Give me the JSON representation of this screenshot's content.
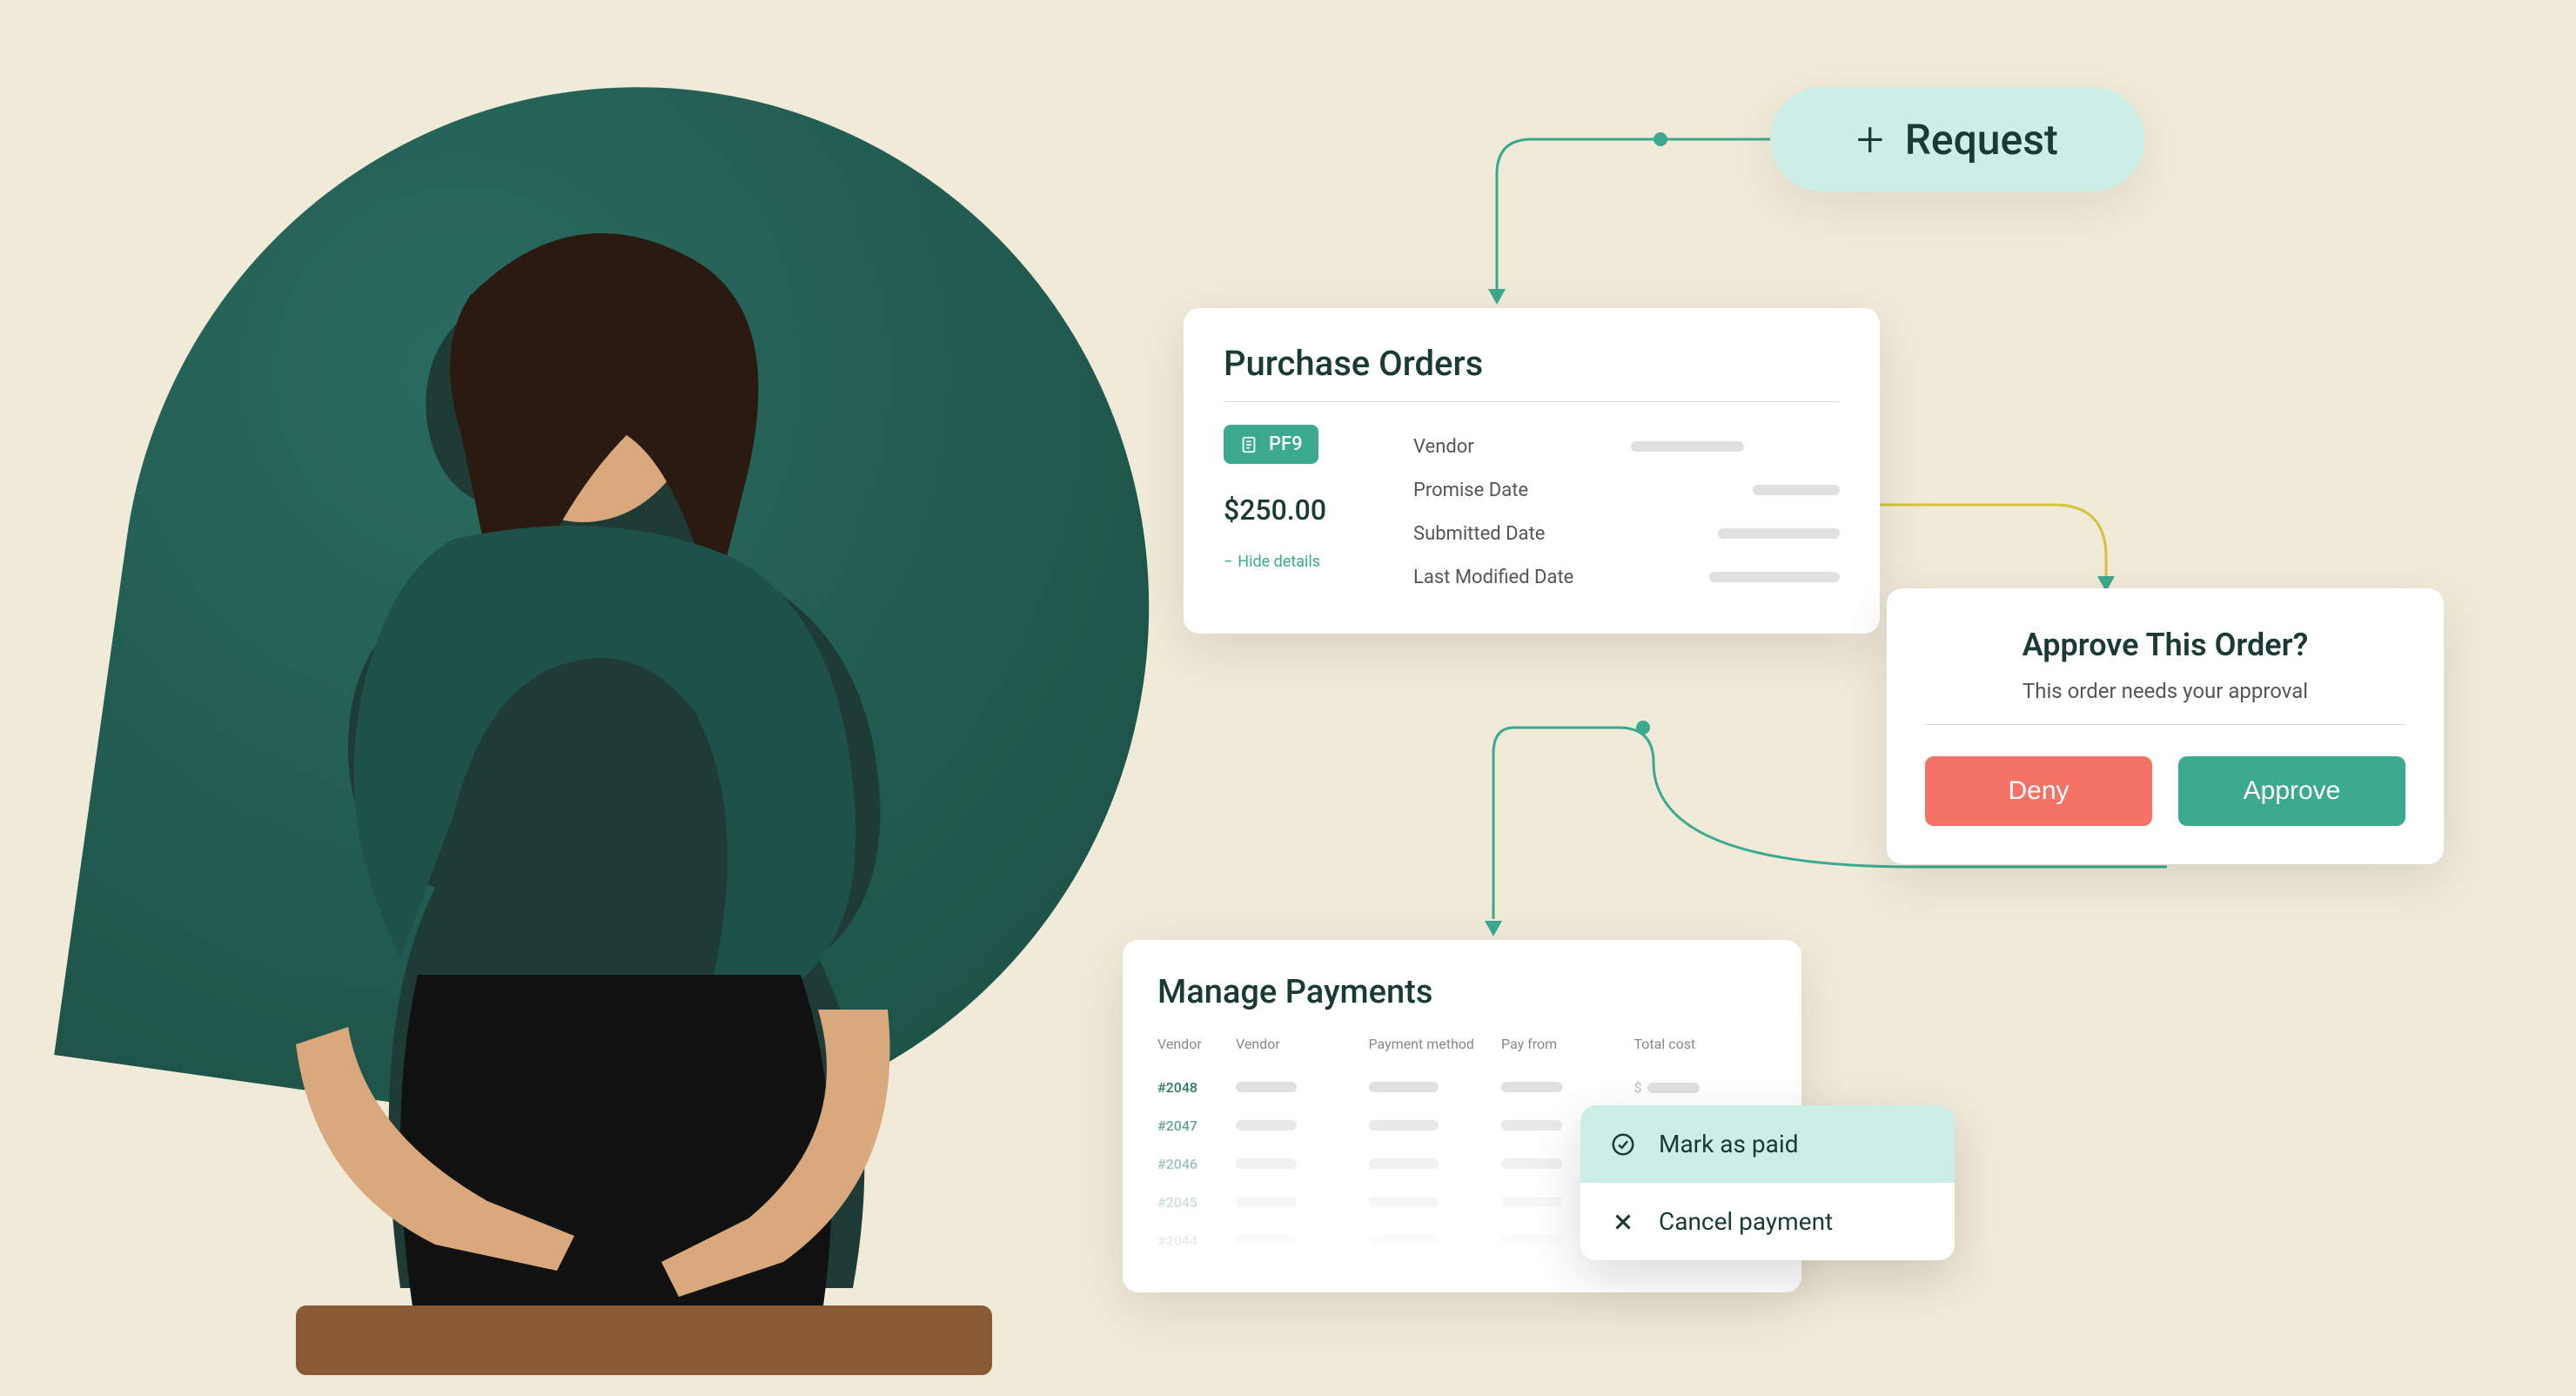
{
  "request": {
    "label": "Request"
  },
  "purchaseOrders": {
    "title": "Purchase Orders",
    "badge": "PF9",
    "price": "$250.00",
    "hideDetails": "Hide details",
    "fields": [
      "Vendor",
      "Promise Date",
      "Submitted Date",
      "Last Modified Date"
    ]
  },
  "approve": {
    "title": "Approve This Order?",
    "subtitle": "This order needs your approval",
    "deny": "Deny",
    "approve": "Approve"
  },
  "managePayments": {
    "title": "Manage Payments",
    "headers": [
      "Vendor",
      "Vendor",
      "Payment method",
      "Pay from",
      "Total cost"
    ],
    "rows": [
      "#2048",
      "#2047",
      "#2046",
      "#2045",
      "#2044"
    ],
    "currency": "$"
  },
  "menu": {
    "markPaid": "Mark as paid",
    "cancel": "Cancel payment"
  }
}
